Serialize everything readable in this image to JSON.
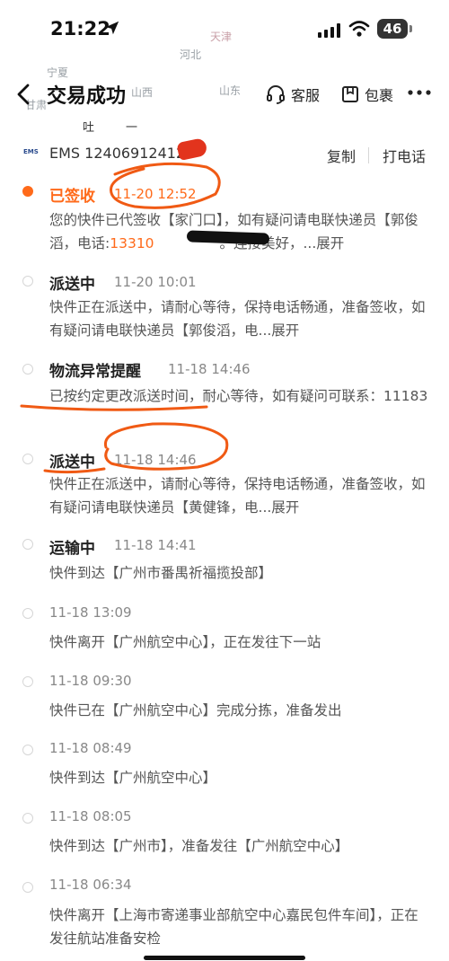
{
  "status_bar": {
    "time": "21:22",
    "battery": "46",
    "icons": [
      "location-arrow-icon",
      "cellular-signal-icon",
      "wifi-icon",
      "battery-icon"
    ]
  },
  "map_labels": [
    "天津",
    "河北",
    "宁夏",
    "甘肃",
    "山西",
    "山东"
  ],
  "nav": {
    "title": "交易成功",
    "service_label": "客服",
    "package_label": "包裹"
  },
  "peek_text": "吐　　一",
  "waybill": {
    "logo": "EMS",
    "number": "EMS 12406912412",
    "copy_label": "复制",
    "call_label": "打电话"
  },
  "events": [
    {
      "title": "已签收",
      "time": "11-20 12:52",
      "active": true,
      "desc_pre": "您的快件已代签收【家门口】，如有疑问请电联快递员【郭俊滔，电话:",
      "desc_phone": "13310",
      "desc_post": " 。连接美好，",
      "expand": "...展开"
    },
    {
      "title": "派送中",
      "time": "11-20 10:01",
      "desc": "快件正在派送中，请耐心等待，保持电话畅通，准备签收，如有疑问请电联快递员【郭俊滔，电",
      "expand": "...展开"
    },
    {
      "title": "物流异常提醒",
      "time": "11-18 14:46",
      "desc": "已按约定更改派送时间，耐心等待，如有疑问可联系：11183"
    },
    {
      "title": "派送中",
      "time": "11-18 14:46",
      "desc": "快件正在派送中，请耐心等待，保持电话畅通，准备签收，如有疑问请电联快递员【黄健锋，电",
      "expand": "...展开"
    },
    {
      "title": "运输中",
      "time": "11-18 14:41",
      "desc": "快件到达【广州市番禺祈福揽投部】"
    },
    {
      "time": "11-18 13:09",
      "desc": "快件离开【广州航空中心】，正在发往下一站"
    },
    {
      "time": "11-18 09:30",
      "desc": "快件已在【广州航空中心】完成分拣，准备发出"
    },
    {
      "time": "11-18 08:49",
      "desc": "快件到达【广州航空中心】"
    },
    {
      "time": "11-18 08:05",
      "desc": "快件到达【广州市】，准备发往【广州航空中心】"
    },
    {
      "time": "11-18 06:34",
      "desc": "快件离开【上海市寄递事业部航空中心嘉民包件车间】，正在发往航站准备安检"
    }
  ],
  "colors": {
    "accent": "#ff6a1a",
    "annotation": "#f05a14",
    "redaction_red": "#e2341d"
  }
}
